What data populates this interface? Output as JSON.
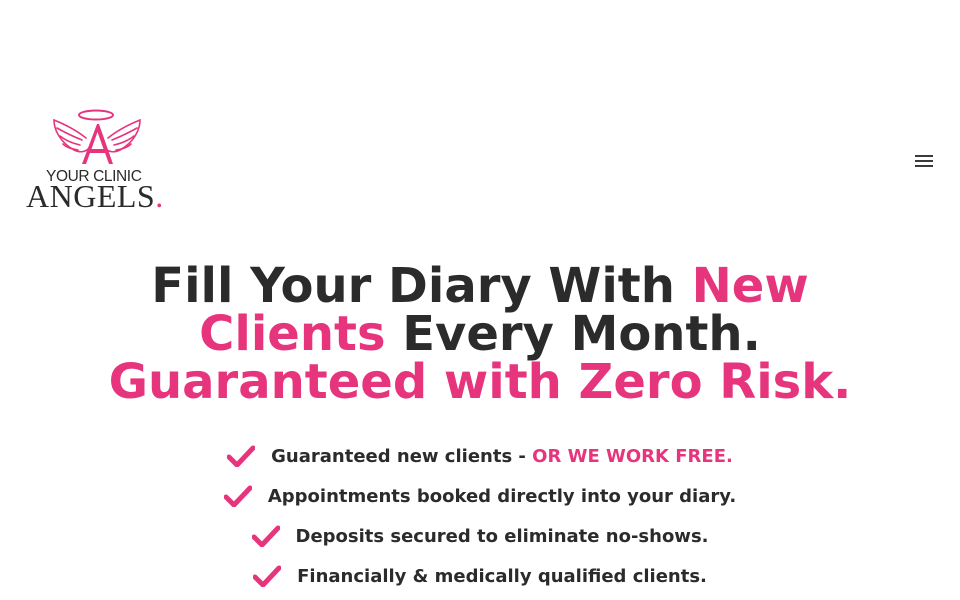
{
  "header": {
    "logo": {
      "top_text": "YOUR CLINIC",
      "main_text": "ANGELS",
      "dot": ".",
      "icon": "angel-wings-halo-icon"
    },
    "menu_icon": "hamburger-menu-icon"
  },
  "hero": {
    "headline": {
      "part1": "Fill Your Diary With ",
      "part2": "New",
      "part3": "Clients",
      "part4": " Every Month.",
      "part5": "Guaranteed with Zero Risk."
    },
    "benefits": [
      {
        "text": "Guaranteed new clients - ",
        "highlight": "OR WE WORK FREE."
      },
      {
        "text": "Appointments booked directly into your diary.",
        "highlight": ""
      },
      {
        "text": "Deposits secured to eliminate no-shows.",
        "highlight": ""
      },
      {
        "text": "Financially & medically qualified clients.",
        "highlight": ""
      }
    ],
    "benefit_icon": "checkmark-icon"
  },
  "colors": {
    "accent": "#e6357d",
    "text": "#2b2b2b",
    "background": "#ffffff"
  }
}
